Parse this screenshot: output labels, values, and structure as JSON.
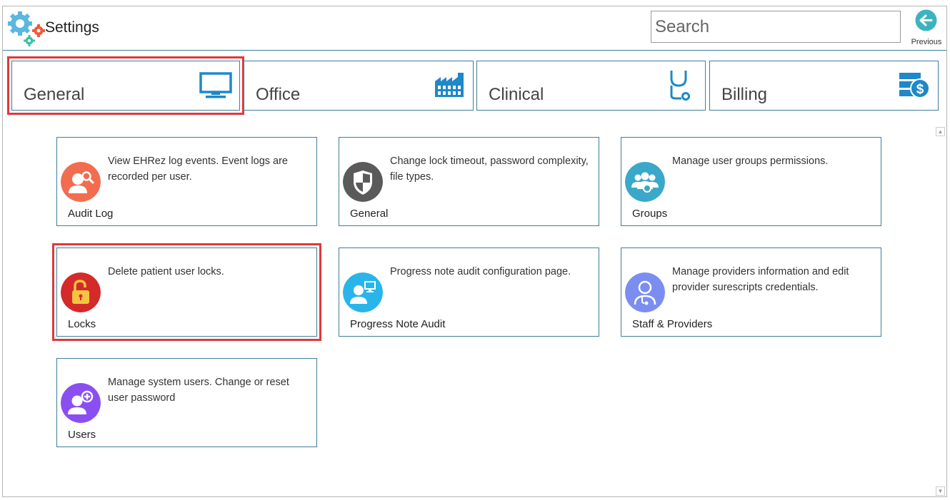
{
  "header": {
    "title": "Settings",
    "search_placeholder": "Search",
    "previous_label": "Previous"
  },
  "tabs": [
    {
      "label": "General",
      "icon": "monitor-icon",
      "active": true
    },
    {
      "label": "Office",
      "icon": "factory-icon"
    },
    {
      "label": "Clinical",
      "icon": "stethoscope-icon"
    },
    {
      "label": "Billing",
      "icon": "billing-server-dollar-icon"
    }
  ],
  "cards": [
    {
      "title": "Audit Log",
      "description": "View EHRez log events. Event logs are recorded per user.",
      "icon": "audit-user-search-icon",
      "color": "#f26c4f"
    },
    {
      "title": "General",
      "description": "Change lock timeout, password complexity, file types.",
      "icon": "shield-icon",
      "color": "#5a5a5a"
    },
    {
      "title": "Groups",
      "description": "Manage user groups permissions.",
      "icon": "group-users-icon",
      "color": "#3aa8c8"
    },
    {
      "title": "Locks",
      "description": "Delete patient user locks.",
      "icon": "padlock-icon",
      "color": "#d42a2a"
    },
    {
      "title": "Progress Note Audit",
      "description": "Progress note audit configuration page.",
      "icon": "user-monitor-icon",
      "color": "#29b5ea"
    },
    {
      "title": "Staff & Providers",
      "description": "Manage providers information and edit provider surescripts credentials.",
      "icon": "doctor-icon",
      "color": "#7b8ef0"
    },
    {
      "title": "Users",
      "description": "Manage system users. Change or reset user password",
      "icon": "add-user-icon",
      "color": "#8a4ff0"
    }
  ],
  "colors": {
    "border": "#3f7f9a",
    "highlight": "#e0383b",
    "accent_blue": "#1e88c8",
    "previous_teal": "#3cb3c0"
  }
}
